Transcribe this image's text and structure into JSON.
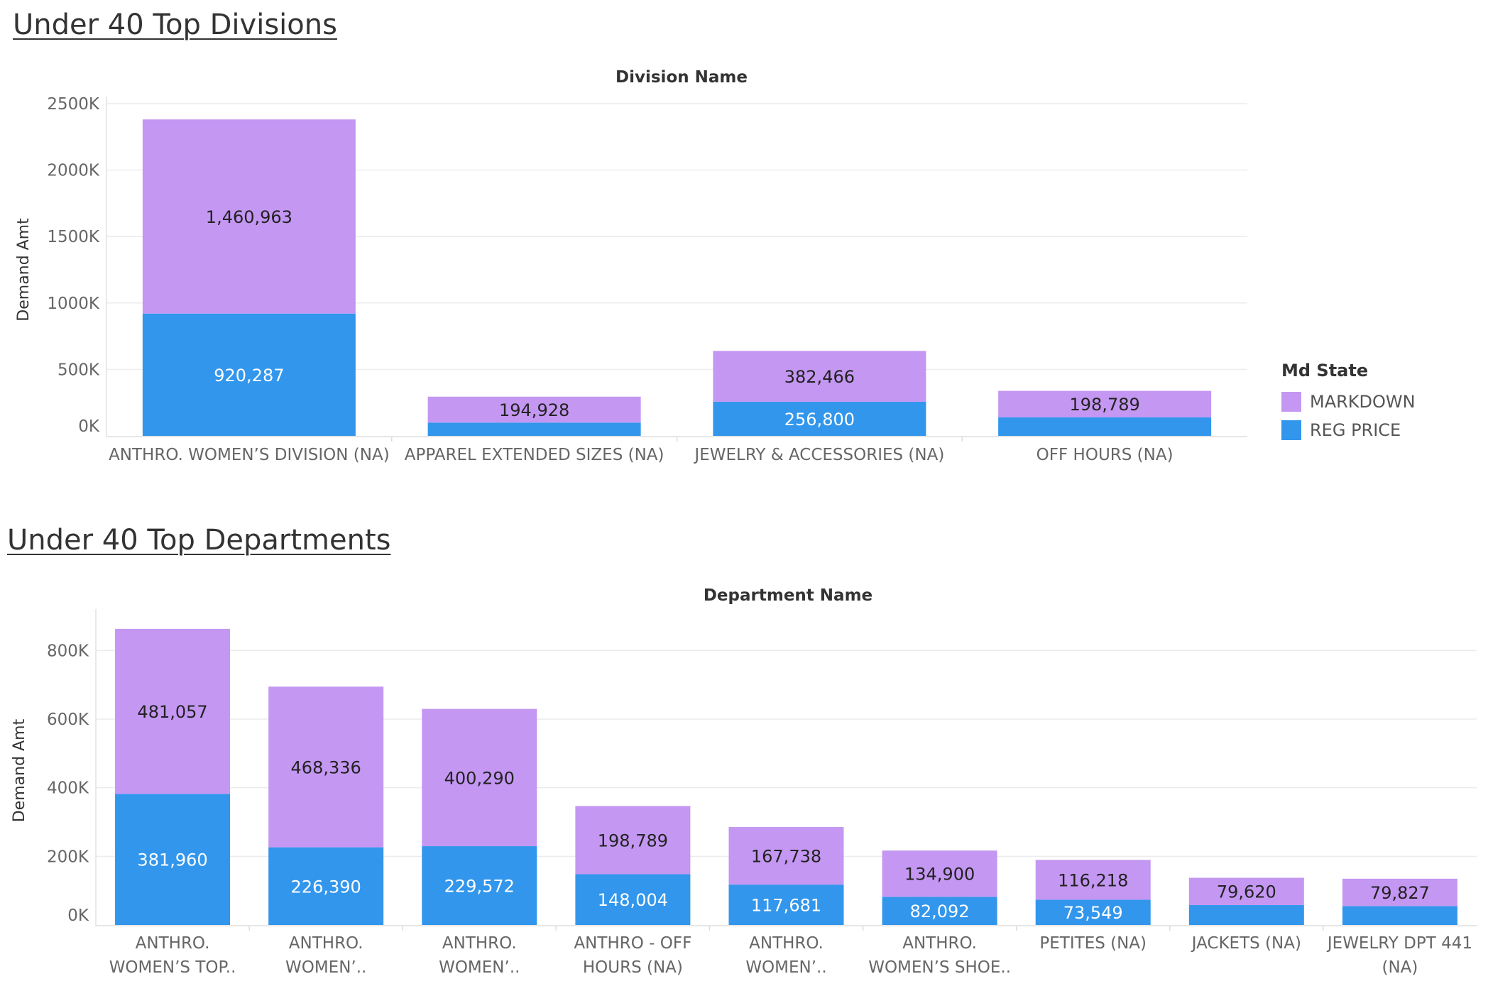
{
  "divisions": {
    "section_title": "Under 40 Top Divisions",
    "chart_data": {
      "type": "bar",
      "stacked": true,
      "title": "Division Name",
      "xlabel": "",
      "ylabel": "Demand Amt",
      "ylim": [
        0,
        2500000
      ],
      "y_ticks": [
        "0K",
        "500K",
        "1000K",
        "1500K",
        "2000K",
        "2500K"
      ],
      "categories": [
        "ANTHRO. WOMEN’S DIVISION (NA)",
        "APPAREL EXTENDED SIZES (NA)",
        "JEWELRY & ACCESSORIES (NA)",
        "OFF HOURS (NA)"
      ],
      "series": [
        {
          "name": "REG PRICE",
          "values": [
            920287,
            100000,
            256800,
            140000
          ],
          "labels": [
            "920,287",
            "",
            "256,800",
            ""
          ]
        },
        {
          "name": "MARKDOWN",
          "values": [
            1460963,
            194928,
            382466,
            198789
          ],
          "labels": [
            "1,460,963",
            "194,928",
            "382,466",
            "198,789"
          ]
        }
      ]
    }
  },
  "departments": {
    "section_title": "Under 40 Top Departments",
    "chart_data": {
      "type": "bar",
      "stacked": true,
      "title": "Department Name",
      "xlabel": "",
      "ylabel": "Demand Amt",
      "ylim": [
        0,
        900000
      ],
      "y_ticks": [
        "0K",
        "200K",
        "400K",
        "600K",
        "800K"
      ],
      "categories": [
        [
          "ANTHRO.",
          "WOMEN’S TOP.."
        ],
        [
          "ANTHRO.",
          "WOMEN’.."
        ],
        [
          "ANTHRO.",
          "WOMEN’.."
        ],
        [
          "ANTHRO - OFF",
          "HOURS (NA)"
        ],
        [
          "ANTHRO.",
          "WOMEN’.."
        ],
        [
          "ANTHRO.",
          "WOMEN’S SHOE.."
        ],
        [
          "PETITES (NA)"
        ],
        [
          "JACKETS (NA)"
        ],
        [
          "JEWELRY DPT 441",
          "(NA)"
        ]
      ],
      "series": [
        {
          "name": "REG PRICE",
          "values": [
            381960,
            226390,
            229572,
            148004,
            117681,
            82092,
            73549,
            58000,
            55000
          ],
          "labels": [
            "381,960",
            "226,390",
            "229,572",
            "148,004",
            "117,681",
            "82,092",
            "73,549",
            "",
            ""
          ]
        },
        {
          "name": "MARKDOWN",
          "values": [
            481057,
            468336,
            400290,
            198789,
            167738,
            134900,
            116218,
            79620,
            79827
          ],
          "labels": [
            "481,057",
            "468,336",
            "400,290",
            "198,789",
            "167,738",
            "134,900",
            "116,218",
            "79,620",
            "79,827"
          ]
        }
      ]
    }
  },
  "legend": {
    "title": "Md State",
    "items": [
      {
        "label": "MARKDOWN",
        "color": "#c497f2"
      },
      {
        "label": "REG PRICE",
        "color": "#3296ec"
      }
    ]
  },
  "colors": {
    "MARKDOWN": "#c497f2",
    "REG PRICE": "#3296ec"
  }
}
